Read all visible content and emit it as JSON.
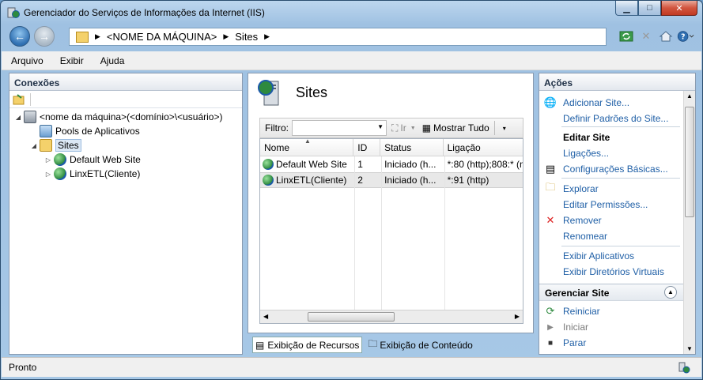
{
  "window": {
    "title": "Gerenciador do Serviços de Informações da Internet (IIS)"
  },
  "caption_buttons": {
    "minimize": "▁",
    "maximize": "□",
    "close": "✕"
  },
  "address": {
    "crumbs": [
      "<NOME DA MÁQUINA>",
      "Sites"
    ]
  },
  "menu": [
    "Arquivo",
    "Exibir",
    "Ajuda"
  ],
  "connections": {
    "title": "Conexões",
    "tree": [
      {
        "label": "<nome da máquina>(<domínio>\\<usuário>)",
        "icon": "server-icon",
        "expander": "◢"
      },
      {
        "label": "Pools de Aplicativos",
        "icon": "app-pool-icon",
        "expander": ""
      },
      {
        "label": "Sites",
        "icon": "sites-folder-icon",
        "expander": "◢"
      },
      {
        "label": "Default Web Site",
        "icon": "globe-icon",
        "expander": "▷"
      },
      {
        "label": "LinxETL(Cliente)",
        "icon": "globe-icon",
        "expander": "▷"
      }
    ]
  },
  "center": {
    "title": "Sites",
    "filter_label": "Filtro:",
    "filter_value": "",
    "go_label": "Ir",
    "show_all_label": "Mostrar Tudo",
    "columns": [
      "Nome",
      "ID",
      "Status",
      "Ligação"
    ],
    "rows": [
      {
        "name": "Default Web Site",
        "id": "1",
        "status": "Iniciado (h...",
        "binding": "*:80 (http);808:* (n"
      },
      {
        "name": "LinxETL(Cliente)",
        "id": "2",
        "status": "Iniciado (h...",
        "binding": "*:91 (http)"
      }
    ],
    "tabs": [
      "Exibição de Recursos",
      "Exibição de Conteúdo"
    ]
  },
  "actions": {
    "title": "Ações",
    "items": [
      {
        "label": "Adicionar Site...",
        "kind": "link",
        "icon": "add-site-icon"
      },
      {
        "label": "Definir Padrões do Site...",
        "kind": "link",
        "icon": ""
      },
      {
        "label": "Editar Site",
        "kind": "header",
        "icon": ""
      },
      {
        "label": "Ligações...",
        "kind": "link",
        "icon": ""
      },
      {
        "label": "Configurações Básicas...",
        "kind": "link",
        "icon": "settings-icon"
      },
      {
        "label": "Explorar",
        "kind": "link",
        "icon": "explore-icon"
      },
      {
        "label": "Editar Permissões...",
        "kind": "link",
        "icon": ""
      },
      {
        "label": "Remover",
        "kind": "link",
        "icon": "remove-icon"
      },
      {
        "label": "Renomear",
        "kind": "link",
        "icon": ""
      },
      {
        "label": "Exibir Aplicativos",
        "kind": "link",
        "icon": ""
      },
      {
        "label": "Exibir Diretórios Virtuais",
        "kind": "link",
        "icon": ""
      }
    ],
    "manage": {
      "title": "Gerenciar Site",
      "items": [
        {
          "label": "Reiniciar",
          "kind": "link",
          "icon": "restart-icon"
        },
        {
          "label": "Iniciar",
          "kind": "disabled",
          "icon": "start-icon"
        },
        {
          "label": "Parar",
          "kind": "link",
          "icon": "stop-icon"
        }
      ]
    }
  },
  "status": {
    "text": "Pronto"
  }
}
